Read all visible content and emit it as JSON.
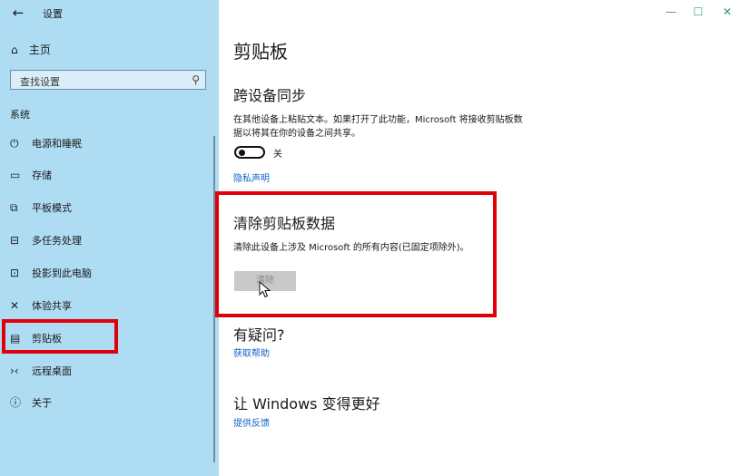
{
  "window": {
    "title": "设置",
    "back_icon": "←",
    "min_icon": "—",
    "max_icon": "☐",
    "close_icon": "✕",
    "accent": "#2f9e5f"
  },
  "sidebar": {
    "home_label": "主页",
    "search_placeholder": "查找设置",
    "section": "系统",
    "items": [
      {
        "label": "电源和睡眠",
        "icon": "⏻"
      },
      {
        "label": "存储",
        "icon": "▭"
      },
      {
        "label": "平板模式",
        "icon": "⧉"
      },
      {
        "label": "多任务处理",
        "icon": "⊟"
      },
      {
        "label": "投影到此电脑",
        "icon": "⊡"
      },
      {
        "label": "体验共享",
        "icon": "✕"
      },
      {
        "label": "剪贴板",
        "icon": "▤"
      },
      {
        "label": "远程桌面",
        "icon": "›‹"
      },
      {
        "label": "关于",
        "icon": "ⓘ"
      }
    ]
  },
  "main": {
    "title": "剪贴板",
    "sync": {
      "heading": "跨设备同步",
      "desc_line1": "在其他设备上粘贴文本。如果打开了此功能，Microsoft 将接收剪贴板数",
      "desc_line2": "据以将其在你的设备之间共享。",
      "toggle_label": "关",
      "toggle_state": "off",
      "privacy_link": "隐私声明"
    },
    "clear": {
      "heading": "清除剪贴板数据",
      "desc": "清除此设备上涉及 Microsoft 的所有内容(已固定项除外)。",
      "button": "清除"
    },
    "questions": {
      "heading": "有疑问?",
      "link": "获取帮助"
    },
    "improve": {
      "heading": "让 Windows 变得更好",
      "link": "提供反馈"
    }
  },
  "highlight_color": "#e0000a"
}
